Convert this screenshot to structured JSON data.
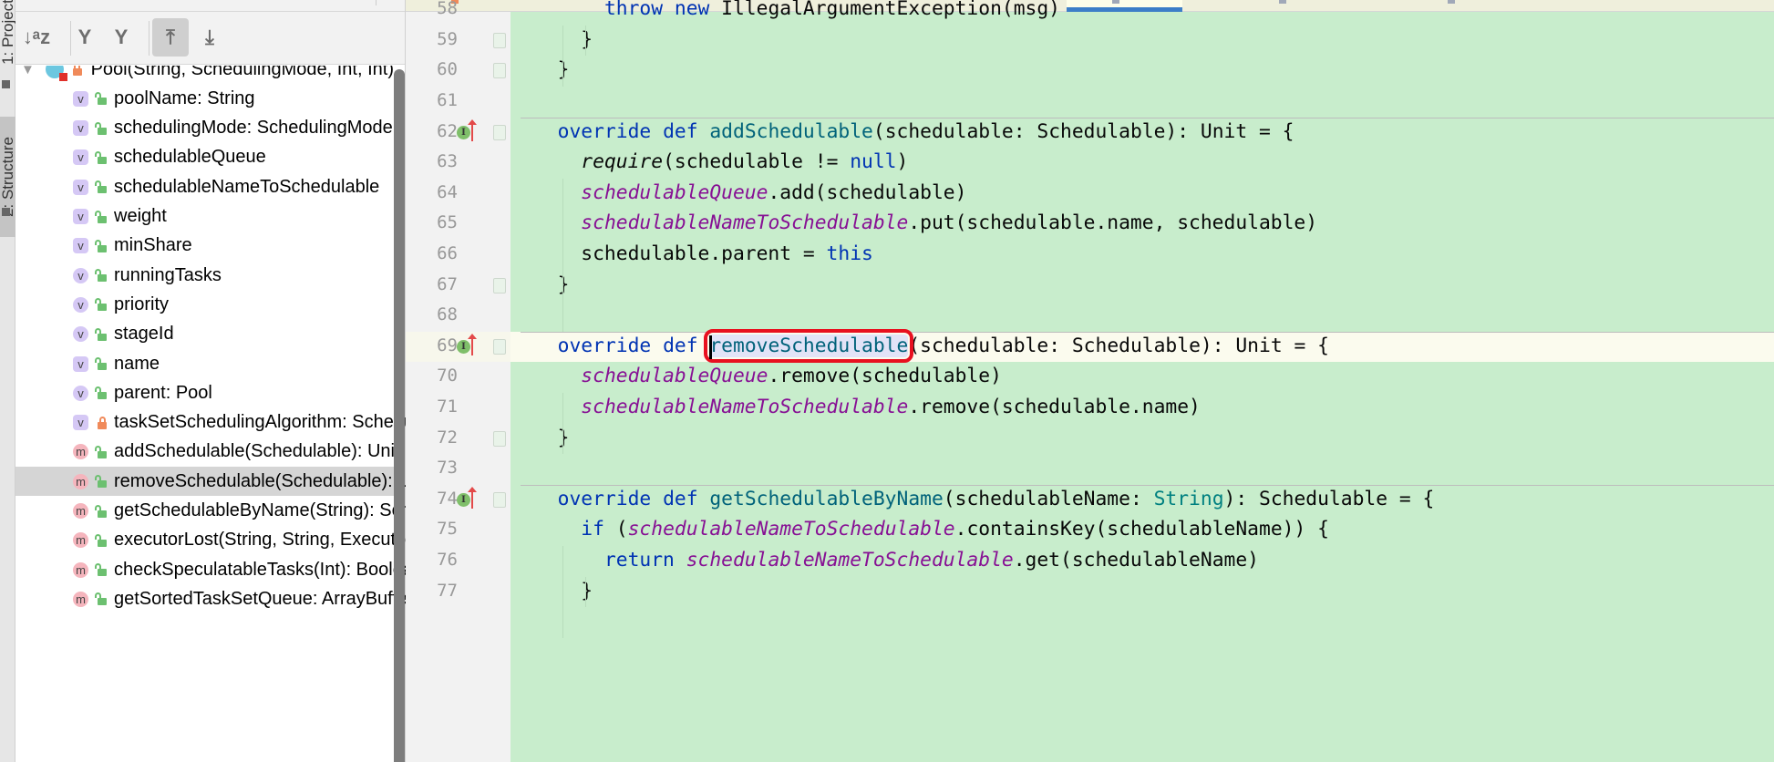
{
  "sidebar_tabs": [
    "1: Project",
    "2: Structure"
  ],
  "toolbar": [
    {
      "icon": "sort-alpha-icon",
      "glyph": "↓ᵃz",
      "active": false
    },
    {
      "icon": "expand-all-icon",
      "glyph": "Y",
      "active": false
    },
    {
      "icon": "collapse-all-icon",
      "glyph": "Y",
      "active": false
    },
    {
      "icon": "autoscroll-from-source-icon",
      "glyph": "⤒",
      "active": true
    },
    {
      "icon": "autoscroll-to-source-icon",
      "glyph": "⤓",
      "active": false
    }
  ],
  "tree": {
    "root": {
      "label": "Pool(String, SchedulingMode, Int, Int)",
      "icon": "class-icon",
      "lock": "closed"
    },
    "items": [
      {
        "icon": "v-square",
        "lock": "open",
        "label": "poolName: String"
      },
      {
        "icon": "v-square",
        "lock": "open",
        "label": "schedulingMode: SchedulingMode"
      },
      {
        "icon": "v-square",
        "lock": "open",
        "label": "schedulableQueue"
      },
      {
        "icon": "v-square",
        "lock": "open",
        "label": "schedulableNameToSchedulable"
      },
      {
        "icon": "v-square",
        "lock": "open",
        "label": "weight"
      },
      {
        "icon": "v-square",
        "lock": "open",
        "label": "minShare"
      },
      {
        "icon": "v-circle",
        "lock": "open",
        "label": "runningTasks"
      },
      {
        "icon": "v-circle",
        "lock": "open",
        "label": "priority"
      },
      {
        "icon": "v-circle",
        "lock": "open",
        "label": "stageId"
      },
      {
        "icon": "v-square",
        "lock": "open",
        "label": "name"
      },
      {
        "icon": "v-circle",
        "lock": "open",
        "label": "parent: Pool"
      },
      {
        "icon": "v-square",
        "lock": "closed",
        "label": "taskSetSchedulingAlgorithm: SchedulingAlgorithm"
      },
      {
        "icon": "m",
        "lock": "open",
        "label": "addSchedulable(Schedulable): Unit"
      },
      {
        "icon": "m",
        "lock": "open",
        "label": "removeSchedulable(Schedulable): Unit",
        "selected": true
      },
      {
        "icon": "m",
        "lock": "open",
        "label": "getSchedulableByName(String): Schedulable"
      },
      {
        "icon": "m",
        "lock": "open",
        "label": "executorLost(String, String, ExecutorLossReason): Unit"
      },
      {
        "icon": "m",
        "lock": "open",
        "label": "checkSpeculatableTasks(Int): Boolean"
      },
      {
        "icon": "m",
        "lock": "open",
        "label": "getSortedTaskSetQueue: ArrayBuffer[TaskSetManager]"
      }
    ]
  },
  "editor": {
    "lines": [
      {
        "num": "58",
        "tokens": [
          [
            "      "
          ],
          [
            "throw",
            "kw"
          ],
          [
            " "
          ],
          [
            "new",
            "kw"
          ],
          [
            " IllegalArgumentException(msg)"
          ]
        ]
      },
      {
        "num": "59",
        "fold": true,
        "tokens": [
          [
            "    }"
          ]
        ]
      },
      {
        "num": "60",
        "fold": true,
        "tokens": [
          [
            "  }"
          ]
        ]
      },
      {
        "num": "61",
        "tokens": []
      },
      {
        "num": "62",
        "sep": true,
        "impl": true,
        "fold": true,
        "tokens": [
          [
            "  "
          ],
          [
            "override",
            "kw"
          ],
          [
            " "
          ],
          [
            "def",
            "kw"
          ],
          [
            " "
          ],
          [
            "addSchedulable",
            "fn"
          ],
          [
            "(schedulable: Schedulable): Unit = {"
          ]
        ]
      },
      {
        "num": "63",
        "tokens": [
          [
            "    "
          ],
          [
            "require",
            "it"
          ],
          [
            "(schedulable != "
          ],
          [
            "null",
            "kw"
          ],
          [
            ")"
          ]
        ]
      },
      {
        "num": "64",
        "tokens": [
          [
            "    "
          ],
          [
            "schedulableQueue",
            "fd"
          ],
          [
            ".add(schedulable)"
          ]
        ]
      },
      {
        "num": "65",
        "tokens": [
          [
            "    "
          ],
          [
            "schedulableNameToSchedulable",
            "fd"
          ],
          [
            ".put(schedulable.name, schedulable)"
          ]
        ]
      },
      {
        "num": "66",
        "tokens": [
          [
            "    schedulable.parent = "
          ],
          [
            "this",
            "kw"
          ]
        ]
      },
      {
        "num": "67",
        "fold": true,
        "tokens": [
          [
            "  }"
          ]
        ]
      },
      {
        "num": "68",
        "tokens": []
      },
      {
        "num": "69",
        "sep": true,
        "impl": true,
        "fold": true,
        "current": true,
        "tokens": [
          [
            "  "
          ],
          [
            "override",
            "kw"
          ],
          [
            " "
          ],
          [
            "def",
            "kw"
          ],
          [
            " "
          ],
          [
            "removeSchedulable",
            "fn hl"
          ],
          [
            "(schedulable: Schedulable): Unit = {"
          ]
        ]
      },
      {
        "num": "70",
        "tokens": [
          [
            "    "
          ],
          [
            "schedulableQueue",
            "fd"
          ],
          [
            ".remove(schedulable)"
          ]
        ]
      },
      {
        "num": "71",
        "tokens": [
          [
            "    "
          ],
          [
            "schedulableNameToSchedulable",
            "fd"
          ],
          [
            ".remove(schedulable.name)"
          ]
        ]
      },
      {
        "num": "72",
        "fold": true,
        "tokens": [
          [
            "  }"
          ]
        ]
      },
      {
        "num": "73",
        "tokens": []
      },
      {
        "num": "74",
        "sep": true,
        "impl": true,
        "fold": true,
        "tokens": [
          [
            "  "
          ],
          [
            "override",
            "kw"
          ],
          [
            " "
          ],
          [
            "def",
            "kw"
          ],
          [
            " "
          ],
          [
            "getSchedulableByName",
            "fn"
          ],
          [
            "(schedulableName: "
          ],
          [
            "String",
            "ty"
          ],
          [
            "): Schedulable = {"
          ]
        ]
      },
      {
        "num": "75",
        "tokens": [
          [
            "    "
          ],
          [
            "if",
            "kw"
          ],
          [
            " ("
          ],
          [
            "schedulableNameToSchedulable",
            "fd"
          ],
          [
            ".containsKey(schedulableName)) {"
          ]
        ]
      },
      {
        "num": "76",
        "tokens": [
          [
            "      "
          ],
          [
            "return",
            "kw"
          ],
          [
            " "
          ],
          [
            "schedulableNameToSchedulable",
            "fd"
          ],
          [
            ".get(schedulableName)"
          ]
        ]
      },
      {
        "num": "77",
        "tokens": [
          [
            "    }"
          ]
        ]
      }
    ]
  },
  "colors": {
    "editor_bg": "#c8edcc",
    "keyword": "#0033b3",
    "function": "#00627a",
    "field": "#871094",
    "highlight_box": "#e8101f"
  }
}
